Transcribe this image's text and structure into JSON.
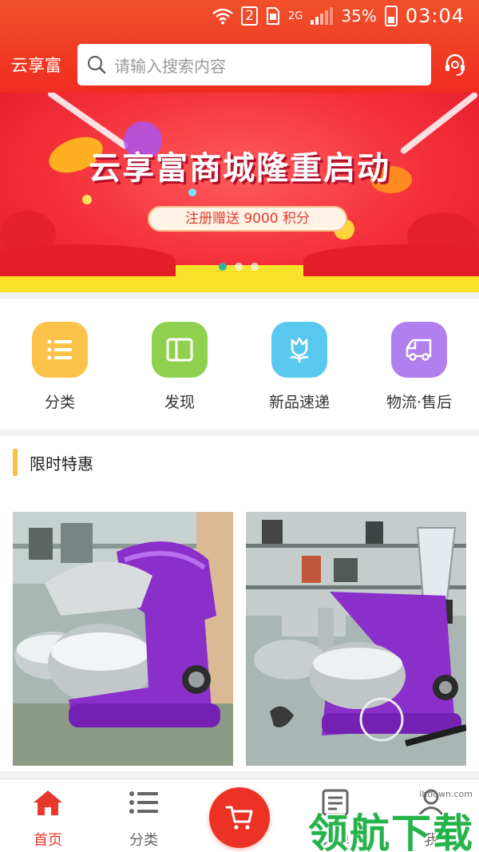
{
  "status": {
    "sim_slot": "2",
    "network": "2G",
    "battery": "35%",
    "battery_level": 0.35,
    "time": "03:04"
  },
  "header": {
    "brand": "云享富",
    "search_placeholder": "请输入搜索内容",
    "icon_search": "search-icon",
    "icon_service": "customer-service-icon"
  },
  "banner": {
    "title": "云享富商城隆重启动",
    "subtitle": "注册赠送 9000 积分",
    "slide_count": 3,
    "active_slide": 1
  },
  "quick_nav": [
    {
      "label": "分类",
      "icon": "list-icon",
      "color": "#fdc24a"
    },
    {
      "label": "发现",
      "icon": "book-icon",
      "color": "#8fd14f"
    },
    {
      "label": "新品速递",
      "icon": "tulip-icon",
      "color": "#58c8ef"
    },
    {
      "label": "物流·售后",
      "icon": "truck-icon",
      "color": "#b080ee"
    }
  ],
  "section": {
    "title": "限时特惠",
    "products": [
      {
        "image": "purple-stand-mixer-photo"
      },
      {
        "image": "purple-stand-mixer-accessories-photo"
      }
    ]
  },
  "tabbar": {
    "items": [
      {
        "label": "首页",
        "icon": "home-icon",
        "active": true
      },
      {
        "label": "分类",
        "icon": "list-icon",
        "active": false
      },
      {
        "label": "",
        "icon": "cart-icon",
        "active": false
      },
      {
        "label": "订单",
        "icon": "order-icon",
        "active": false
      },
      {
        "label": "我",
        "icon": "user-icon",
        "active": false
      }
    ],
    "accent": "#e8382b"
  },
  "watermark": {
    "text": "领航下载",
    "url": "lhdown.com"
  }
}
